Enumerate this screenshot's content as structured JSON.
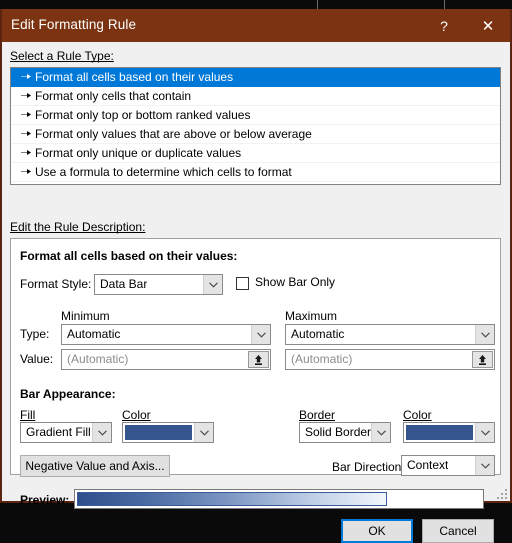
{
  "window": {
    "title": "Edit Formatting Rule",
    "help_label": "?",
    "close_label": "✕",
    "titlebar_color": "#7b3311",
    "border_color": "#5c2310"
  },
  "rule_type": {
    "section_label": "Select a Rule Type:",
    "marker": "➜",
    "selected_index": 0,
    "selection_color": "#0078d7",
    "items": [
      {
        "label": "Format all cells based on their values"
      },
      {
        "label": "Format only cells that contain"
      },
      {
        "label": "Format only top or bottom ranked values"
      },
      {
        "label": "Format only values that are above or below average"
      },
      {
        "label": "Format only unique or duplicate values"
      },
      {
        "label": "Use a formula to determine which cells to format"
      }
    ]
  },
  "description": {
    "section_label": "Edit the Rule Description:",
    "heading": "Format all cells based on their values:",
    "format_style": {
      "label": "Format Style:",
      "value": "Data Bar"
    },
    "show_bar_only": {
      "label": "Show Bar Only",
      "checked": false
    },
    "minimum": {
      "header": "Minimum",
      "type_value": "Automatic",
      "value_placeholder": "(Automatic)",
      "value": ""
    },
    "maximum": {
      "header": "Maximum",
      "type_value": "Automatic",
      "value_placeholder": "(Automatic)",
      "value": ""
    },
    "row_labels": {
      "type": "Type:",
      "value": "Value:"
    },
    "bar_appearance": {
      "heading": "Bar Appearance:",
      "fill": {
        "label": "Fill",
        "value": "Gradient Fill"
      },
      "fill_color": {
        "label": "Color",
        "value": "#35558e"
      },
      "border": {
        "label": "Border",
        "value": "Solid Border"
      },
      "border_color": {
        "label": "Color",
        "value": "#35558e"
      }
    },
    "negative_value_button": "Negative Value and Axis...",
    "bar_direction": {
      "label": "Bar Direction:",
      "value": "Context"
    },
    "preview": {
      "label": "Preview:",
      "gradient_start": "#2f4f8c",
      "gradient_end": "#f2f6fc",
      "bar_border": "#3a5b9b"
    }
  },
  "footer": {
    "ok_label": "OK",
    "cancel_label": "Cancel"
  }
}
